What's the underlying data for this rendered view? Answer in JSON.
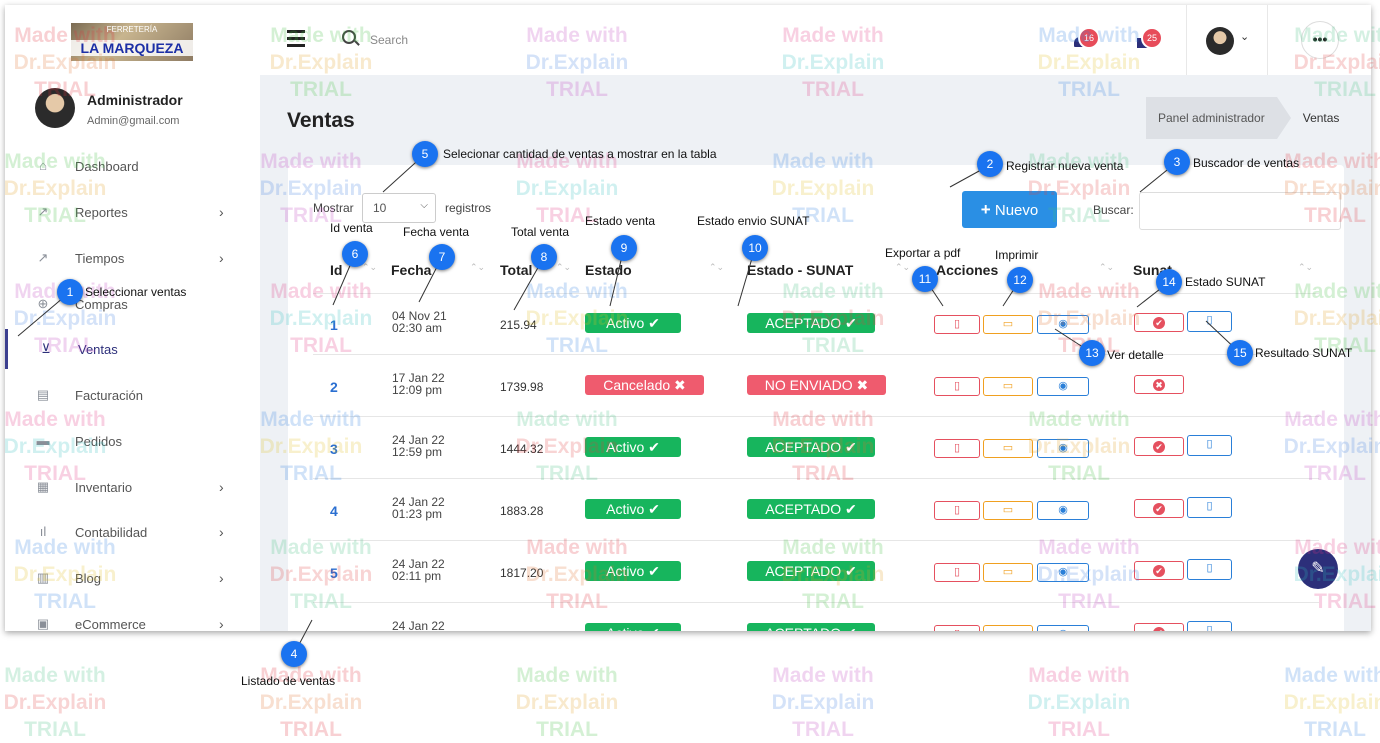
{
  "sidebar": {
    "logo_top": "FERRETERÍA",
    "logo_text": "LA MARQUEZA",
    "user_name": "Administrador",
    "user_email": "Admin@gmail.com",
    "items": [
      {
        "label": "Dashboard",
        "icon": "home-icon",
        "chevron": false
      },
      {
        "label": "Reportes",
        "icon": "chart-line-icon",
        "chevron": true
      },
      {
        "label": "Tiempos",
        "icon": "chart-line-icon",
        "chevron": true
      },
      {
        "label": "Compras",
        "icon": "cart-plus-icon",
        "chevron": false
      },
      {
        "label": "Ventas",
        "icon": "cart-icon",
        "chevron": false,
        "active": true
      },
      {
        "label": "Facturación",
        "icon": "file-icon",
        "chevron": false
      },
      {
        "label": "Pedidos",
        "icon": "truck-icon",
        "chevron": false
      },
      {
        "label": "Inventario",
        "icon": "boxes-icon",
        "chevron": true
      },
      {
        "label": "Contabilidad",
        "icon": "signal-bars-icon",
        "chevron": true
      },
      {
        "label": "Blog",
        "icon": "book-icon",
        "chevron": true
      },
      {
        "label": "eCommerce",
        "icon": "shopping-bag-icon",
        "chevron": true
      }
    ]
  },
  "topbar": {
    "search_placeholder": "Search",
    "notif_count": "16",
    "mail_count": "25",
    "more": "•••"
  },
  "page": {
    "title": "Ventas",
    "breadcrumb_root": "Panel administrador",
    "breadcrumb_current": "Ventas"
  },
  "table_controls": {
    "show_label": "Mostrar",
    "show_value": "10",
    "records_label": "registros",
    "new_button": "Nuevo",
    "search_label": "Buscar:"
  },
  "table": {
    "headers": [
      "Id",
      "Fecha",
      "Total",
      "Estado",
      "Estado - SUNAT",
      "Acciones",
      "Sunat"
    ],
    "rows": [
      {
        "id": "1",
        "date": "04 Nov 21",
        "time": "02:30 am",
        "total": "215.94",
        "estado": "Activo",
        "sunat": "ACEPTADO",
        "sunat_ok": true
      },
      {
        "id": "2",
        "date": "17 Jan 22",
        "time": "12:09 pm",
        "total": "1739.98",
        "estado": "Cancelado",
        "sunat": "NO ENVIADO",
        "sunat_ok": false
      },
      {
        "id": "3",
        "date": "24 Jan 22",
        "time": "12:59 pm",
        "total": "1444.32",
        "estado": "Activo",
        "sunat": "ACEPTADO",
        "sunat_ok": true
      },
      {
        "id": "4",
        "date": "24 Jan 22",
        "time": "01:23 pm",
        "total": "1883.28",
        "estado": "Activo",
        "sunat": "ACEPTADO",
        "sunat_ok": true
      },
      {
        "id": "5",
        "date": "24 Jan 22",
        "time": "02:11 pm",
        "total": "1817.20",
        "estado": "Activo",
        "sunat": "ACEPTADO",
        "sunat_ok": true
      },
      {
        "id": "",
        "date": "24 Jan 22",
        "time": "",
        "total": "",
        "estado": "Activo",
        "sunat": "ACEPTADO",
        "sunat_ok": true
      }
    ]
  },
  "callouts": [
    {
      "n": "1",
      "text": "Seleccionar ventas"
    },
    {
      "n": "2",
      "text": "Registrar nueva venta"
    },
    {
      "n": "3",
      "text": "Buscador de ventas"
    },
    {
      "n": "4",
      "text": "Listado de ventas"
    },
    {
      "n": "5",
      "text": "Selecionar cantidad de ventas a mostrar en la tabla"
    },
    {
      "n": "6",
      "text": "Id venta"
    },
    {
      "n": "7",
      "text": "Fecha venta"
    },
    {
      "n": "8",
      "text": "Total venta"
    },
    {
      "n": "9",
      "text": "Estado venta"
    },
    {
      "n": "10",
      "text": "Estado envio SUNAT"
    },
    {
      "n": "11",
      "text": "Exportar a pdf"
    },
    {
      "n": "12",
      "text": "Imprimir"
    },
    {
      "n": "13",
      "text": "Ver detalle"
    },
    {
      "n": "14",
      "text": "Estado SUNAT"
    },
    {
      "n": "15",
      "text": "Resultado SUNAT"
    }
  ],
  "watermark": [
    "Made with",
    "Dr.Explain",
    "TRIAL"
  ],
  "colors": {
    "accent": "#2a8fe4",
    "green": "#17b55d",
    "red": "#ef5b6e",
    "callout": "#1a73f0",
    "nav_active": "#2c2f7a"
  }
}
